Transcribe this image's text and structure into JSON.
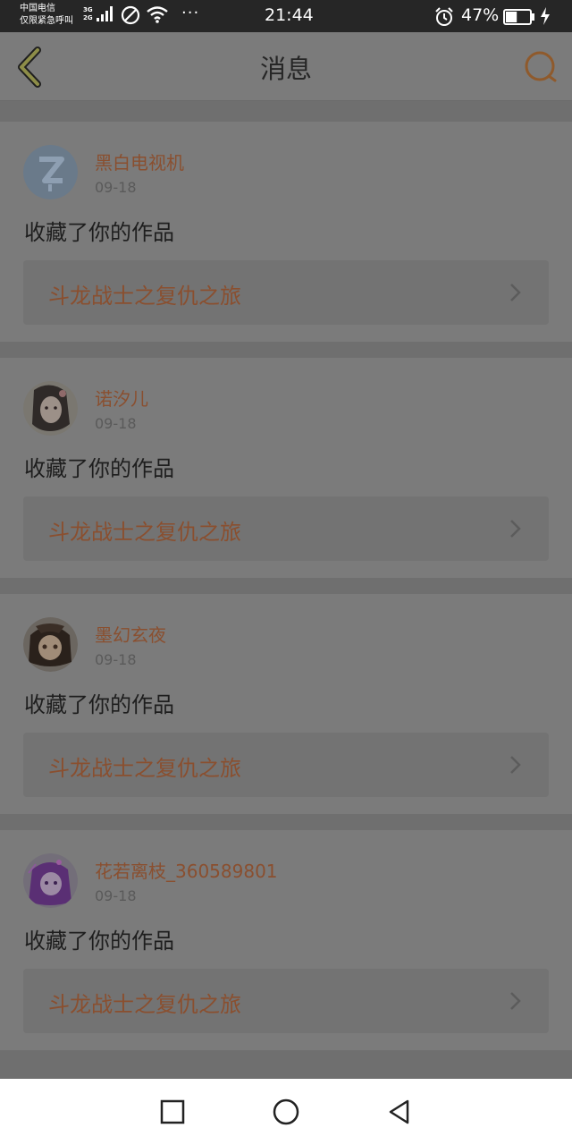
{
  "status": {
    "carrier_line1": "中国电信",
    "carrier_line2": "仅限紧急呼叫",
    "net_top": "3G",
    "net_bottom": "2G",
    "time": "21:44",
    "battery_percent": "47%",
    "battery_level": 0.47,
    "overflow": "···"
  },
  "header": {
    "title": "消息",
    "back_icon": "chevron-left-icon",
    "search_icon": "search-icon",
    "accent_color": "#8f5a2c"
  },
  "messages": [
    {
      "username": "黑白电视机",
      "date": "09-18",
      "action": "收藏了你的作品",
      "work_title": "斗龙战士之复仇之旅",
      "avatar": "default-avatar-icon"
    },
    {
      "username": "诺汐儿",
      "date": "09-18",
      "action": "收藏了你的作品",
      "work_title": "斗龙战士之复仇之旅",
      "avatar": "anime-girl-avatar"
    },
    {
      "username": "墨幻玄夜",
      "date": "09-18",
      "action": "收藏了你的作品",
      "work_title": "斗龙战士之复仇之旅",
      "avatar": "anime-character-avatar"
    },
    {
      "username": "花若离枝_360589801",
      "date": "09-18",
      "action": "收藏了你的作品",
      "work_title": "斗龙战士之复仇之旅",
      "avatar": "purple-hair-avatar"
    }
  ],
  "navbar": {
    "recent_icon": "square-icon",
    "home_icon": "circle-icon",
    "back_icon": "triangle-back-icon"
  }
}
